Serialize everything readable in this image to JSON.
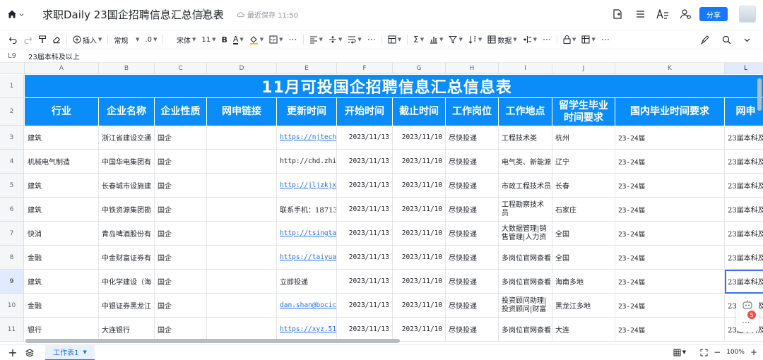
{
  "document": {
    "title": "求职Daily 23国企招聘信息汇总信息表",
    "saved_status": "最近保存 11:50",
    "share_label": "分享"
  },
  "toolbar": {
    "insert_label": "插入",
    "format_label": "常规",
    "decimal_label": ".0",
    "font_label": "宋体",
    "size_label": "11",
    "data_label": "数据",
    "bold_label": "B",
    "text_color_label": "A"
  },
  "formula_bar": {
    "cell_ref": "L9",
    "value": "23届本科及以上"
  },
  "sheet": {
    "banner": "11月可投国企招聘信息汇总信息表",
    "columns": [
      "A",
      "B",
      "C",
      "D",
      "E",
      "F",
      "G",
      "H",
      "I",
      "J",
      "K",
      "L"
    ],
    "row_numbers": [
      "1",
      "2",
      "3",
      "4",
      "5",
      "6",
      "7",
      "8",
      "9",
      "10",
      "11"
    ],
    "headers": [
      "行业",
      "企业名称",
      "企业性质",
      "网申链接",
      "更新时间",
      "开始时间",
      "截止时间",
      "工作岗位",
      "工作地点",
      "留学生毕业时间要求",
      "国内毕业时间要求",
      "网申"
    ],
    "rows": [
      [
        "建筑",
        "浙江省建设交通",
        "国企",
        "",
        "https://njtech.",
        "2023/11/13",
        "2023/11/10",
        "尽快投递",
        "工程技术类",
        "杭州",
        "23-24届",
        "23届本科及"
      ],
      [
        "机械电气制造",
        "中国华电集团有",
        "国企",
        "",
        "http://chd.zhi",
        "2023/11/13",
        "2023/11/10",
        "尽快投递",
        "电气类、新能源",
        "辽宁",
        "23-24届",
        "23届本科及"
      ],
      [
        "建筑",
        "长春城市设施建",
        "国企",
        "",
        "http://jljzkjx",
        "2023/11/13",
        "2023/11/10",
        "尽快投递",
        "市政工程技术员",
        "长春",
        "23-24届",
        "23届本科及"
      ],
      [
        "建筑",
        "中铁资源集团勘",
        "国企",
        "",
        "联系手机：18713",
        "2023/11/13",
        "2023/11/10",
        "尽快投递",
        "工程勘察技术员",
        "石家庄",
        "23-24届",
        "23届本科及"
      ],
      [
        "快消",
        "青岛啤酒股份有",
        "国企",
        "",
        "http://tsingta",
        "2023/11/13",
        "2023/11/10",
        "尽快投递",
        "大数据管理|销售管理|人力资",
        "全国",
        "23-24届",
        "23届本科及"
      ],
      [
        "金融",
        "中金财富证券有",
        "国企",
        "",
        "https://taiyua",
        "2023/11/13",
        "2023/11/10",
        "尽快投递",
        "多岗位官网查看",
        "全国",
        "23-24届",
        "23届本科及"
      ],
      [
        "建筑",
        "中化学建设（海",
        "国企",
        "",
        "立即投递",
        "2023/11/13",
        "2023/11/10",
        "尽快投递",
        "多岗位官网查看",
        "海南多地",
        "23-24届",
        "23届本科及"
      ],
      [
        "金融",
        "中银证券黑龙江",
        "国企",
        "",
        "dan.shan@bocic",
        "2023/11/13",
        "2023/11/10",
        "尽快投递",
        "投资顾问助理|投资顾问|财富",
        "黑龙江多地",
        "23-24届",
        "23届本科及"
      ],
      [
        "银行",
        "大连银行",
        "国企",
        "",
        "https://xyz.51",
        "2023/11/13",
        "2023/11/10",
        "尽快投递",
        "多岗位官网查看",
        "大连",
        "23-24届",
        "23届本科及"
      ]
    ]
  },
  "float": {
    "badge_count": "5",
    "more_label": "···"
  },
  "bottom": {
    "sheet_tab": "工作表1",
    "zoom": "100%",
    "minus": "−",
    "plus": "+"
  },
  "colors": {
    "header_blue": "#0a8df8",
    "accent": "#1677ff",
    "link": "#1f6ef2"
  }
}
